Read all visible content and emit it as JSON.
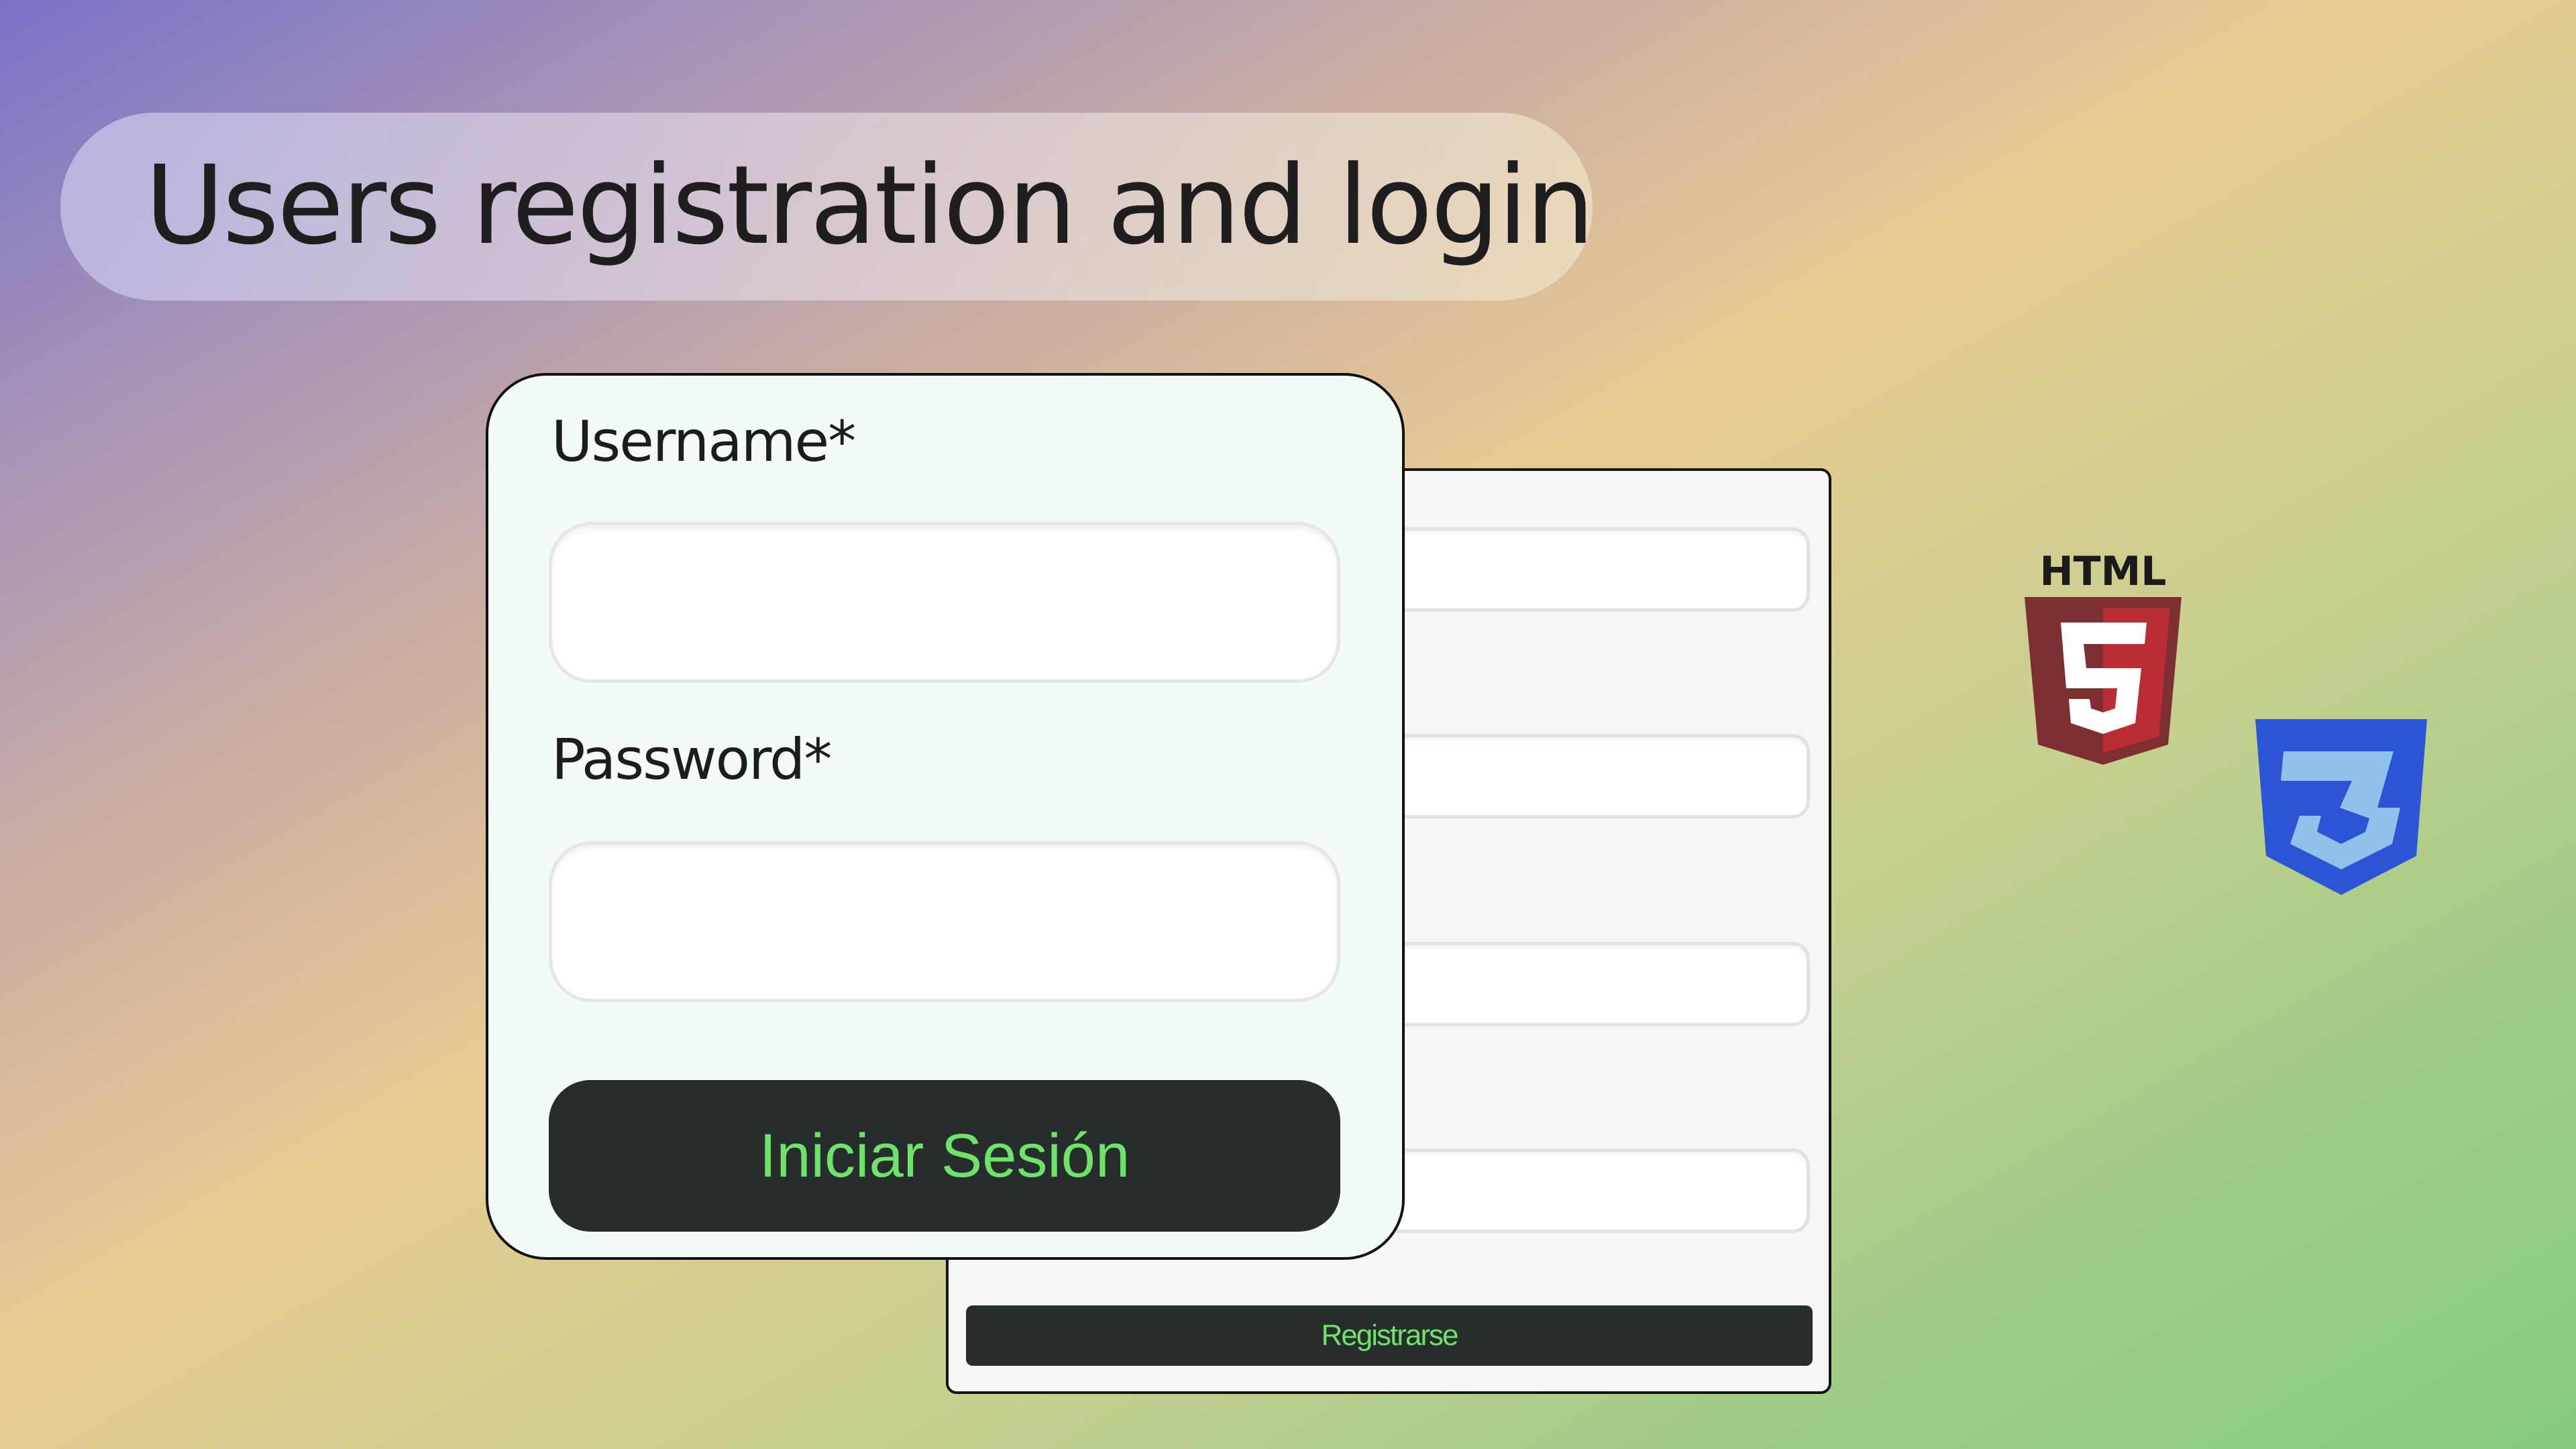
{
  "header": {
    "title": "Users registration and login"
  },
  "login_form": {
    "username_label": "Username*",
    "password_label": "Password*",
    "username_value": "",
    "password_value": "",
    "submit_label": "Iniciar Sesión"
  },
  "registration_form": {
    "submit_label": "Registrarse",
    "field_values": [
      "",
      "",
      "",
      ""
    ]
  },
  "logos": {
    "html5_text": "HTML",
    "html5_numeral": "5"
  },
  "colors": {
    "button_bg": "#262d2c",
    "button_text": "#6fe26a",
    "html5_primary": "#e44d26",
    "css3_primary": "#2965f1"
  }
}
